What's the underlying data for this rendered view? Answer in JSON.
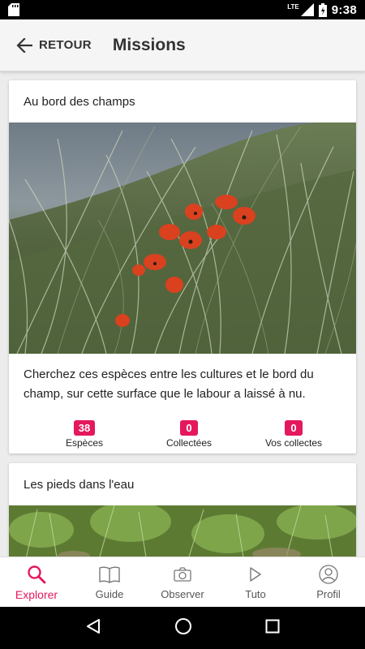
{
  "status_bar": {
    "network": "LTE",
    "time": "9:38"
  },
  "header": {
    "back_label": "RETOUR",
    "title": "Missions"
  },
  "missions": [
    {
      "title": "Au bord des champs",
      "description": "Cherchez ces espèces entre les cultures et le bord du champ, sur cette surface que le labour a laissé à nu.",
      "stats": [
        {
          "value": "38",
          "label": "Espèces"
        },
        {
          "value": "0",
          "label": "Collectées"
        },
        {
          "value": "0",
          "label": "Vos collectes"
        }
      ]
    },
    {
      "title": "Les pieds dans l'eau"
    }
  ],
  "bottom_nav": [
    {
      "label": "Explorer",
      "icon": "search-icon",
      "active": true
    },
    {
      "label": "Guide",
      "icon": "book-icon",
      "active": false
    },
    {
      "label": "Observer",
      "icon": "camera-icon",
      "active": false
    },
    {
      "label": "Tuto",
      "icon": "play-icon",
      "active": false
    },
    {
      "label": "Profil",
      "icon": "user-icon",
      "active": false
    }
  ],
  "colors": {
    "accent": "#e5175d"
  }
}
